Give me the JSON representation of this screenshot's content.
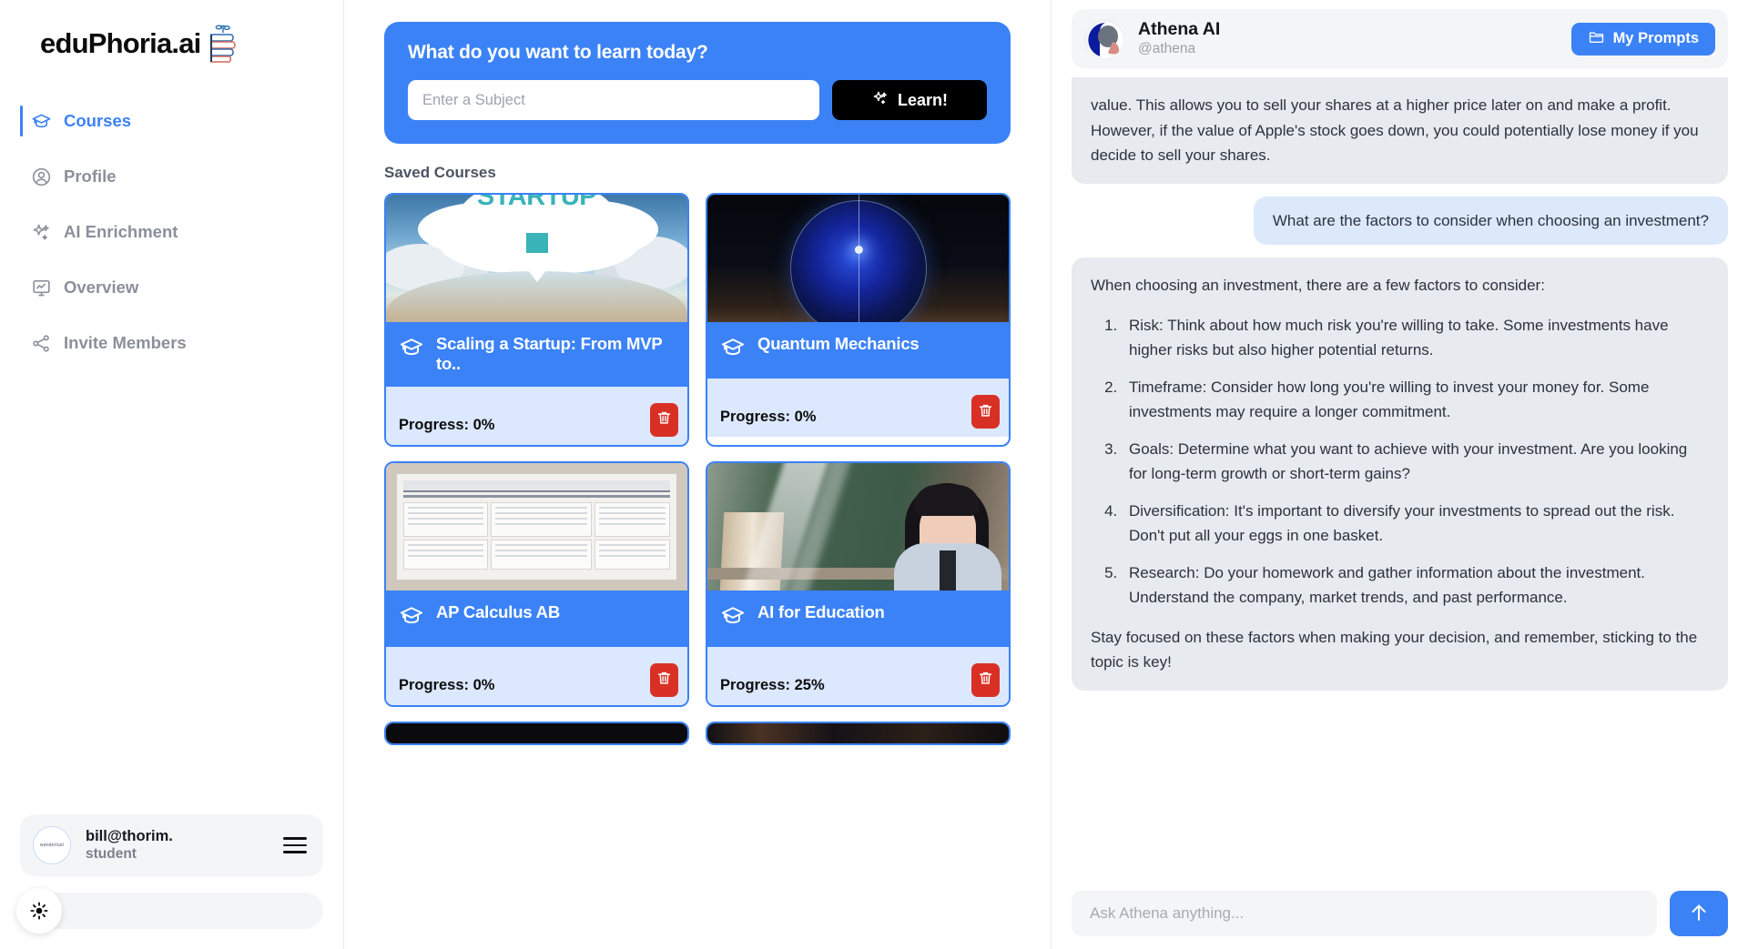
{
  "brand": {
    "name": "eduPhoria.ai",
    "logo_icon": "stacked-books-icon"
  },
  "sidebar": {
    "items": [
      {
        "label": "Courses",
        "icon": "graduation-cap-icon",
        "active": true
      },
      {
        "label": "Profile",
        "icon": "user-circle-icon",
        "active": false
      },
      {
        "label": "AI Enrichment",
        "icon": "sparkles-icon",
        "active": false
      },
      {
        "label": "Overview",
        "icon": "chart-board-icon",
        "active": false
      },
      {
        "label": "Invite Members",
        "icon": "share-icon",
        "active": false
      }
    ],
    "user": {
      "email": "bill@thorim.",
      "role": "student",
      "avatar_text": "wanderlust",
      "menu_icon": "hamburger-icon"
    },
    "theme_toggle": {
      "icon": "sun-icon",
      "label": ""
    }
  },
  "learn_panel": {
    "title": "What do you want to learn today?",
    "input_placeholder": "Enter a Subject",
    "input_value": "",
    "button_label": "Learn!",
    "button_icon": "sparkles-icon"
  },
  "courses_section": {
    "label": "Saved Courses",
    "cards": [
      {
        "title": "Scaling a Startup: From MVP to..",
        "progress_label": "Progress: 0%",
        "progress_value": 0,
        "icon": "graduation-cap-icon",
        "delete_icon": "trash-icon",
        "art": "art-sky",
        "art_text": "STARTUP"
      },
      {
        "title": "Quantum Mechanics",
        "progress_label": "Progress: 0%",
        "progress_value": 0,
        "icon": "graduation-cap-icon",
        "delete_icon": "trash-icon",
        "art": "art-quantum",
        "art_text": ""
      },
      {
        "title": "AP Calculus AB",
        "progress_label": "Progress: 0%",
        "progress_value": 0,
        "icon": "graduation-cap-icon",
        "delete_icon": "trash-icon",
        "art": "art-doc",
        "art_text": ""
      },
      {
        "title": "AI for Education",
        "progress_label": "Progress: 25%",
        "progress_value": 25,
        "icon": "graduation-cap-icon",
        "delete_icon": "trash-icon",
        "art": "art-class",
        "art_text": ""
      }
    ]
  },
  "chat": {
    "name": "Athena AI",
    "handle": "@athena",
    "avatar_icon": "athena-avatar",
    "prompts_button": {
      "label": "My Prompts",
      "icon": "folder-icon"
    },
    "messages": [
      {
        "sender": "bot",
        "truncated": true,
        "paragraphs": [
          "value. This allows you to sell your shares at a higher price later on and make a profit. However, if the value of Apple's stock goes down, you could potentially lose money if you decide to sell your shares."
        ],
        "list": []
      },
      {
        "sender": "user",
        "truncated": false,
        "paragraphs": [
          "What are the factors to consider when choosing an investment?"
        ],
        "list": []
      },
      {
        "sender": "bot",
        "truncated": false,
        "paragraphs": [
          "When choosing an investment, there are a few factors to consider:"
        ],
        "list": [
          "Risk: Think about how much risk you're willing to take. Some investments have higher risks but also higher potential returns.",
          "Timeframe: Consider how long you're willing to invest your money for. Some investments may require a longer commitment.",
          "Goals: Determine what you want to achieve with your investment. Are you looking for long-term growth or short-term gains?",
          "Diversification: It's important to diversify your investments to spread out the risk. Don't put all your eggs in one basket.",
          "Research: Do your homework and gather information about the investment. Understand the company, market trends, and past performance."
        ],
        "closing": "Stay focused on these factors when making your decision, and remember, sticking to the topic is key!"
      }
    ],
    "composer": {
      "placeholder": "Ask Athena anything...",
      "value": "",
      "send_icon": "arrow-up-icon"
    }
  },
  "colors": {
    "accent_blue": "#3b82f6",
    "card_footer": "#dbe8fd",
    "delete_red": "#d93025",
    "bot_bubble": "#e7eaee",
    "user_bubble": "#dce9fb",
    "muted_text": "#8a909a"
  }
}
